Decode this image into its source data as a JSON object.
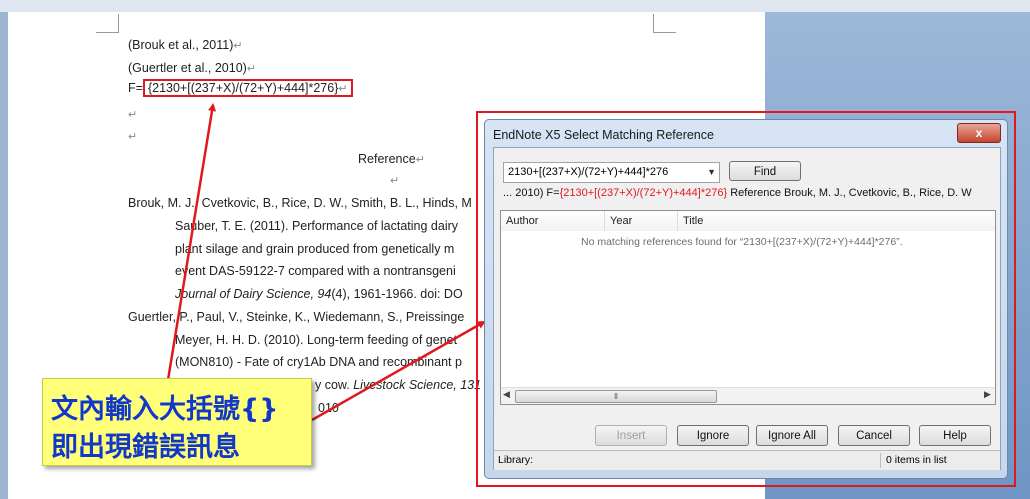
{
  "document": {
    "lines": [
      "(Brouk et al., 2011)",
      "(Guertler et al., 2010)"
    ],
    "formula_prefix": "F=",
    "formula": "{2130+[(237+X)/(72+Y)+444]*276}",
    "heading": "Reference",
    "ref1": {
      "line1": "Brouk, M. J., Cvetkovic, B., Rice, D. W., Smith, B. L., Hinds, M",
      "line2": "Sauber, T. E. (2011).  Performance of lactating dairy",
      "line3": "plant silage and grain produced from genetically m",
      "line4": "event DAS-59122-7  compared with a nontransgeni",
      "line5_italic": "Journal of Dairy Science, 94",
      "line5_rest": "(4), 1961-1966.  doi: DO"
    },
    "ref2": {
      "line1": "Guertler, P., Paul, V., Steinke, K., Wiedemann, S., Preissinge",
      "line2": "Meyer, H. H. D. (2010).  Long-term feeding of genet",
      "line3": "(MON810) - Fate of cry1Ab DNA and recombinant p",
      "line4_rest": "y cow.",
      "line4_italic": "Livestock Science, 131",
      "line5": "010"
    }
  },
  "callout": {
    "line1": "文內輸入大括號{}",
    "line2": "即出現錯誤訊息"
  },
  "dialog": {
    "title": "EndNote X5 Select Matching Reference",
    "close_label": "x",
    "search_value": "2130+[(237+X)/(72+Y)+444]*276",
    "find_label": "Find",
    "context_prefix": "... 2010) F=",
    "context_highlight": "{2130+[(237+X)/(72+Y)+444]*276}",
    "context_suffix": " Reference  Brouk, M. J., Cvetkovic, B., Rice, D. W",
    "columns": [
      "Author",
      "Year",
      "Title"
    ],
    "no_match": "No matching references found for “2130+[(237+X)/(72+Y)+444]*276”.",
    "buttons": {
      "insert": "Insert",
      "ignore": "Ignore",
      "ignore_all": "Ignore All",
      "cancel": "Cancel",
      "help": "Help"
    },
    "status_left": "Library:",
    "status_right": "0 items in list"
  },
  "colors": {
    "highlight_red": "#e0191f",
    "callout_yellow": "#ffff7a",
    "callout_text": "#1238c8"
  }
}
